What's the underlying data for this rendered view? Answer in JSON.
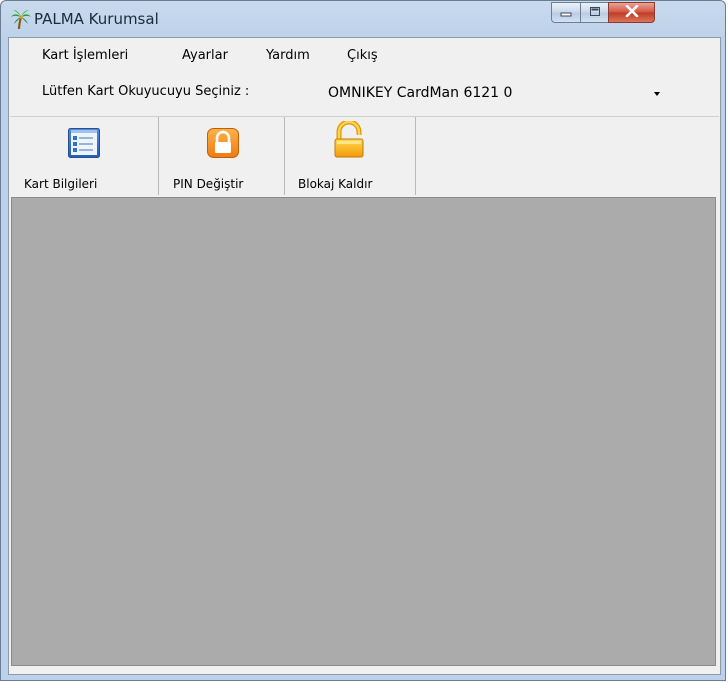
{
  "window": {
    "title": "PALMA Kurumsal",
    "icon": "palm-tree-icon"
  },
  "menubar": {
    "items": [
      {
        "label": "Kart İşlemleri"
      },
      {
        "label": "Ayarlar"
      },
      {
        "label": "Yardım"
      },
      {
        "label": "Çıkış"
      }
    ]
  },
  "reader": {
    "label": "Lütfen Kart Okuyucuyu Seçiniz :",
    "selected": "OMNIKEY CardMan 6121 0"
  },
  "toolbar": {
    "buttons": [
      {
        "label": "Kart Bilgileri",
        "icon": "card-info-icon"
      },
      {
        "label": "PIN Değiştir",
        "icon": "lock-closed-icon"
      },
      {
        "label": "Blokaj Kaldır",
        "icon": "lock-open-icon"
      }
    ]
  },
  "colors": {
    "content_background": "#ababab",
    "close_button": "#c13a22"
  }
}
